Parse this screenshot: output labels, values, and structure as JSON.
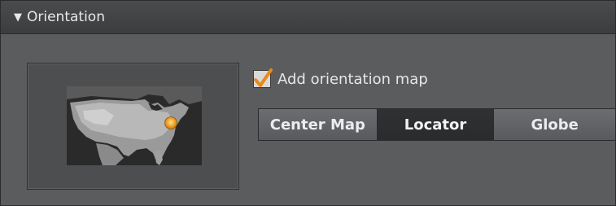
{
  "panel": {
    "title": "Orientation",
    "collapse_icon": "triangle-down-icon"
  },
  "preview": {
    "image": "us-map-locator-thumbnail",
    "marker_color": "#f0a02a"
  },
  "add_orientation_map": {
    "label": "Add orientation map",
    "checked": true,
    "check_color": "#e8891c"
  },
  "map_modes": {
    "options": [
      "Center Map",
      "Locator",
      "Globe"
    ],
    "selected": "Locator"
  }
}
